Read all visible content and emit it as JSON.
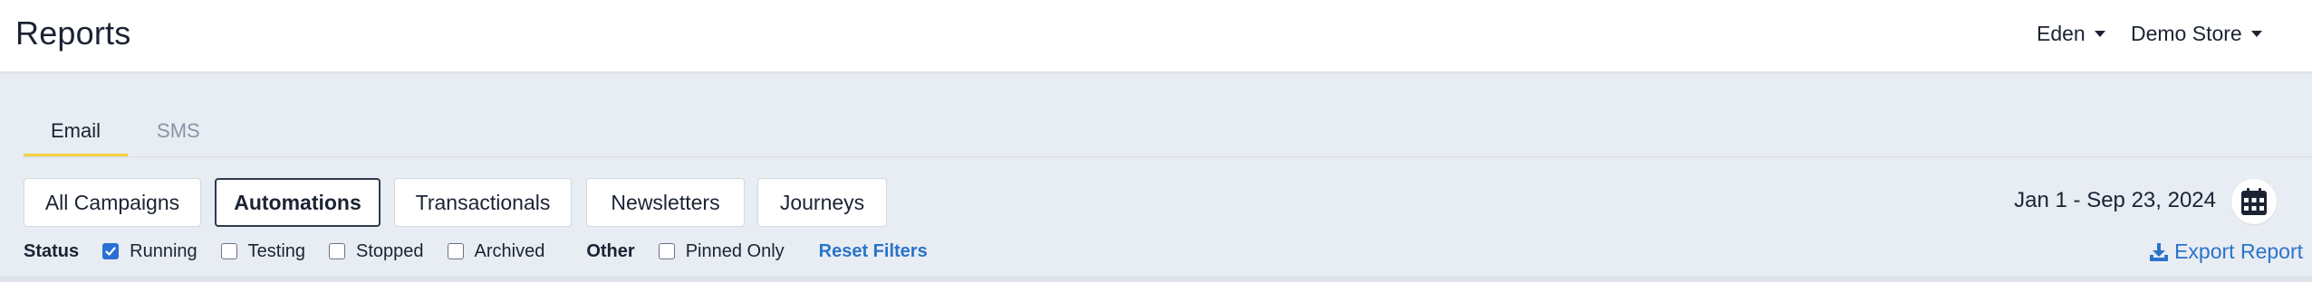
{
  "header": {
    "title": "Reports",
    "user_menu": "Eden",
    "store_menu": "Demo Store"
  },
  "tabs": [
    {
      "label": "Email",
      "active": true
    },
    {
      "label": "SMS",
      "active": false
    }
  ],
  "campaign_filters": [
    {
      "label": "All Campaigns",
      "active": false
    },
    {
      "label": "Automations",
      "active": true
    },
    {
      "label": "Transactionals",
      "active": false
    },
    {
      "label": "Newsletters",
      "active": false
    },
    {
      "label": "Journeys",
      "active": false
    }
  ],
  "date_range": "Jan 1 - Sep 23, 2024",
  "status_filter": {
    "label": "Status",
    "options": [
      {
        "label": "Running",
        "checked": true
      },
      {
        "label": "Testing",
        "checked": false
      },
      {
        "label": "Stopped",
        "checked": false
      },
      {
        "label": "Archived",
        "checked": false
      }
    ]
  },
  "other_filter": {
    "label": "Other",
    "options": [
      {
        "label": "Pinned Only",
        "checked": false
      }
    ]
  },
  "reset_label": "Reset Filters",
  "export_label": "Export Report",
  "colors": {
    "accent": "#2a74c9",
    "tab_underline": "#f2d23b",
    "background": "#e8ecf3"
  }
}
